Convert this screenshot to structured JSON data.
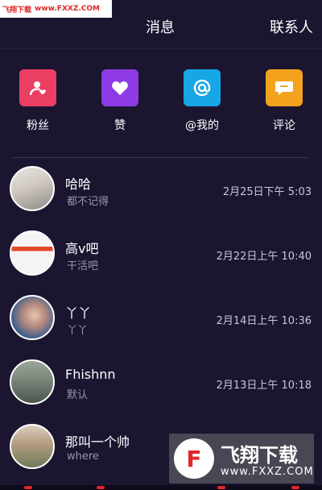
{
  "watermark_top": {
    "site_name": "飞翔下载",
    "url": "www.FXXZ.COM"
  },
  "header": {
    "tabs": [
      {
        "label": "消息"
      },
      {
        "label": "联系人"
      }
    ]
  },
  "quick_actions": [
    {
      "label": "粉丝",
      "icon": "fans-icon",
      "color": "#ea3f62"
    },
    {
      "label": "赞",
      "icon": "heart-icon",
      "color": "#8e3be6"
    },
    {
      "label": "@我的",
      "icon": "at-icon",
      "color": "#17a6e6"
    },
    {
      "label": "评论",
      "icon": "comment-icon",
      "color": "#f2a21c"
    }
  ],
  "conversations": [
    {
      "name": "哈哈",
      "preview": "都不记得",
      "time": "2月25日下午 5:03"
    },
    {
      "name": "高v吧",
      "preview": "干活吧",
      "time": "2月22日上午 10:40"
    },
    {
      "name": "丫丫",
      "preview": "丫丫",
      "time": "2月14日上午 10:36"
    },
    {
      "name": "Fhishnn",
      "preview": "默认",
      "time": "2月13日上午 10:18"
    },
    {
      "name": "那叫一个帅",
      "preview": "where",
      "time": ""
    }
  ],
  "watermark_bottom": {
    "name": "飞翔下载",
    "url": "www.FXXZ.COM"
  },
  "colors": {
    "background": "#1b1530",
    "accent_red": "#e0262b"
  }
}
